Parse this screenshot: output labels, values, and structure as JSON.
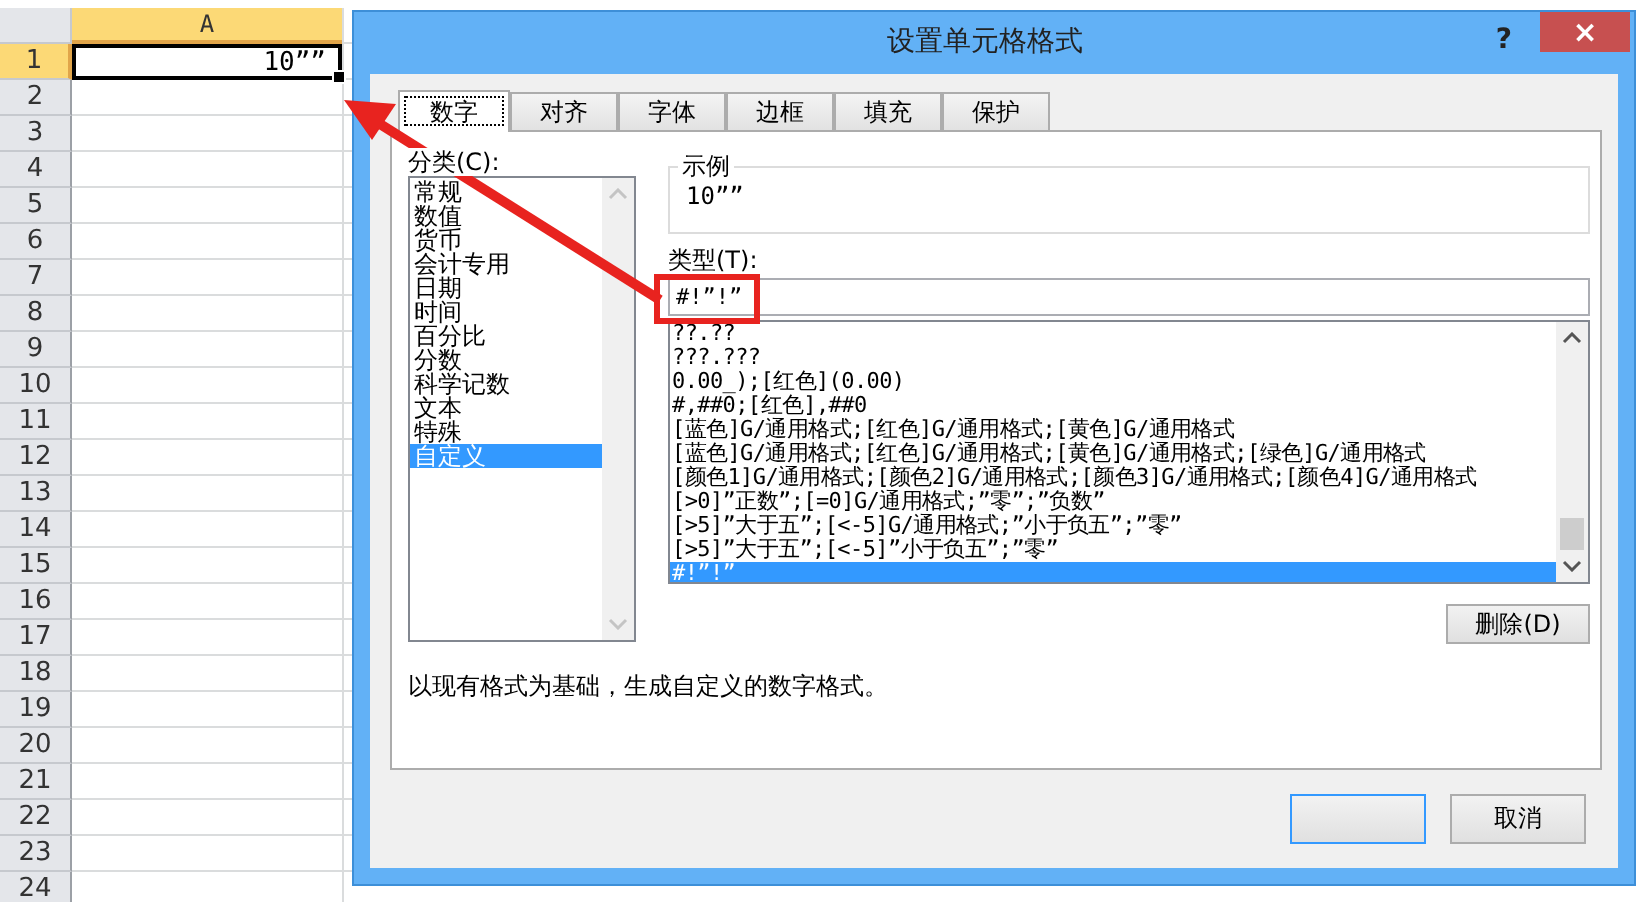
{
  "sheet": {
    "column_header": "A",
    "rows": [
      {
        "number": "1",
        "value": "10””",
        "selected": true
      },
      {
        "number": "2",
        "value": "",
        "selected": false
      },
      {
        "number": "3",
        "value": "",
        "selected": false
      },
      {
        "number": "4",
        "value": "",
        "selected": false
      },
      {
        "number": "5",
        "value": "",
        "selected": false
      },
      {
        "number": "6",
        "value": "",
        "selected": false
      },
      {
        "number": "7",
        "value": "",
        "selected": false
      },
      {
        "number": "8",
        "value": "",
        "selected": false
      },
      {
        "number": "9",
        "value": "",
        "selected": false
      },
      {
        "number": "10",
        "value": "",
        "selected": false
      },
      {
        "number": "11",
        "value": "",
        "selected": false
      },
      {
        "number": "12",
        "value": "",
        "selected": false
      },
      {
        "number": "13",
        "value": "",
        "selected": false
      },
      {
        "number": "14",
        "value": "",
        "selected": false
      },
      {
        "number": "15",
        "value": "",
        "selected": false
      },
      {
        "number": "16",
        "value": "",
        "selected": false
      },
      {
        "number": "17",
        "value": "",
        "selected": false
      },
      {
        "number": "18",
        "value": "",
        "selected": false
      },
      {
        "number": "19",
        "value": "",
        "selected": false
      },
      {
        "number": "20",
        "value": "",
        "selected": false
      },
      {
        "number": "21",
        "value": "",
        "selected": false
      },
      {
        "number": "22",
        "value": "",
        "selected": false
      },
      {
        "number": "23",
        "value": "",
        "selected": false
      },
      {
        "number": "24",
        "value": "",
        "selected": false
      }
    ]
  },
  "dialog": {
    "title": "设置单元格格式",
    "help": "?",
    "close": "×",
    "tabs": [
      {
        "label": "数字",
        "selected": true
      },
      {
        "label": "对齐",
        "selected": false
      },
      {
        "label": "字体",
        "selected": false
      },
      {
        "label": "边框",
        "selected": false
      },
      {
        "label": "填充",
        "selected": false
      },
      {
        "label": "保护",
        "selected": false
      }
    ],
    "category_label": "分类(C):",
    "categories": [
      {
        "label": "常规",
        "selected": false
      },
      {
        "label": "数值",
        "selected": false
      },
      {
        "label": "货币",
        "selected": false
      },
      {
        "label": "会计专用",
        "selected": false
      },
      {
        "label": "日期",
        "selected": false
      },
      {
        "label": "时间",
        "selected": false
      },
      {
        "label": "百分比",
        "selected": false
      },
      {
        "label": "分数",
        "selected": false
      },
      {
        "label": "科学记数",
        "selected": false
      },
      {
        "label": "文本",
        "selected": false
      },
      {
        "label": "特殊",
        "selected": false
      },
      {
        "label": "自定义",
        "selected": true
      }
    ],
    "sample_label": "示例",
    "sample_value": "10””",
    "type_label": "类型(T):",
    "type_value": "#!”!”",
    "formats": [
      {
        "label": "??.??",
        "selected": false
      },
      {
        "label": "???.???",
        "selected": false
      },
      {
        "label": "0.00_);[红色](0.00)",
        "selected": false
      },
      {
        "label": "#,##0;[红色],##0",
        "selected": false
      },
      {
        "label": "[蓝色]G/通用格式;[红色]G/通用格式;[黄色]G/通用格式",
        "selected": false
      },
      {
        "label": "[蓝色]G/通用格式;[红色]G/通用格式;[黄色]G/通用格式;[绿色]G/通用格式",
        "selected": false
      },
      {
        "label": "[颜色1]G/通用格式;[颜色2]G/通用格式;[颜色3]G/通用格式;[颜色4]G/通用格式",
        "selected": false
      },
      {
        "label": "[>0]”正数”;[=0]G/通用格式;”零”;”负数”",
        "selected": false
      },
      {
        "label": "[>5]”大于五”;[<-5]G/通用格式;”小于负五”;”零”",
        "selected": false
      },
      {
        "label": "[>5]”大于五”;[<-5]”小于负五”;”零”",
        "selected": false
      },
      {
        "label": "#!”!”",
        "selected": true
      }
    ],
    "delete_button": "删除(D)",
    "description": "以现有格式为基础，生成自定义的数字格式。",
    "cancel_button": "取消"
  }
}
